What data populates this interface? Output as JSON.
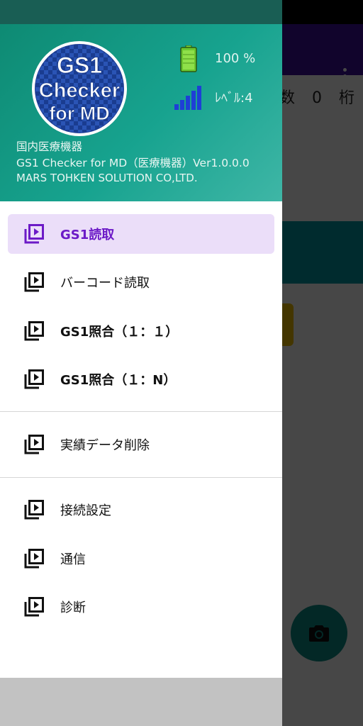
{
  "background": {
    "counter_suffix": "数",
    "counter_value": "0",
    "counter_unit": "桁"
  },
  "header": {
    "logo": {
      "line1": "GS1",
      "line2": "Checker",
      "line3": "for MD"
    },
    "battery": {
      "text": "100 %",
      "level": 1.0,
      "icon": "battery-icon"
    },
    "signal": {
      "text": "ﾚﾍﾞﾙ:4",
      "bars": 4,
      "icon": "signal-bars-icon"
    },
    "category": "国内医療機器",
    "app_name": "GS1 Checker for MD（医療機器）Ver1.0.0.0",
    "company": "MARS TOHKEN SOLUTION CO,LTD."
  },
  "menu": {
    "items": [
      {
        "label": "GS1読取",
        "active": true,
        "icon": "video-library-icon"
      },
      {
        "label": "バーコード読取",
        "active": false,
        "icon": "video-library-icon"
      },
      {
        "label": "GS1照合（１：１）",
        "active": false,
        "icon": "video-library-icon"
      },
      {
        "label": "GS1照合（１：N）",
        "active": false,
        "icon": "video-library-icon"
      },
      {
        "label": "実績データ削除",
        "active": false,
        "icon": "video-library-icon"
      },
      {
        "label": "接続設定",
        "active": false,
        "icon": "video-library-icon"
      },
      {
        "label": "通信",
        "active": false,
        "icon": "video-library-icon"
      },
      {
        "label": "診断",
        "active": false,
        "icon": "video-library-icon"
      }
    ]
  },
  "colors": {
    "header_gradient_start": "#0e8a73",
    "header_gradient_end": "#3fb6a6",
    "active_bg": "#ebdef9",
    "active_text": "#6c1ac7",
    "appbar": "#3e0f9e",
    "fab": "#0c8f88"
  }
}
